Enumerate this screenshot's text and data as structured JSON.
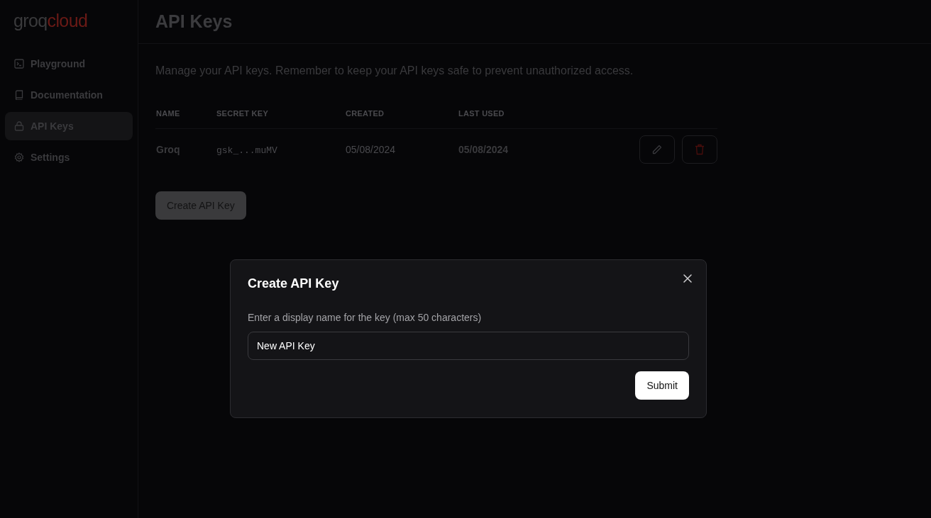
{
  "logo": {
    "part_1": "groq",
    "part_2": "cloud"
  },
  "sidebar": {
    "items": [
      {
        "label": "Playground",
        "selected": false
      },
      {
        "label": "Documentation",
        "selected": false
      },
      {
        "label": "API Keys",
        "selected": true
      },
      {
        "label": "Settings",
        "selected": false
      }
    ]
  },
  "page": {
    "title": "API Keys",
    "description": "Manage your API keys. Remember to keep your API keys safe to prevent unauthorized access."
  },
  "table": {
    "columns": [
      "NAME",
      "SECRET KEY",
      "CREATED",
      "LAST USED"
    ],
    "rows": [
      {
        "name": "Groq",
        "secret_key": "gsk_...muMV",
        "created": "05/08/2024",
        "last_used": "05/08/2024"
      }
    ]
  },
  "create_button": "Create API Key",
  "dialog": {
    "title": "Create API Key",
    "label": "Enter a display name for the key (max 50 characters)",
    "value": "New API Key",
    "submit": "Submit"
  }
}
